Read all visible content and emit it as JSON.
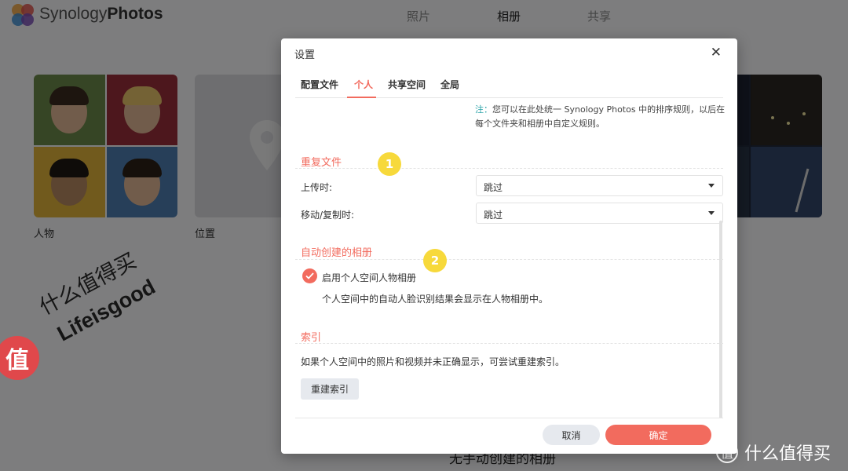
{
  "app": {
    "brand_light": "Synology",
    "brand_bold": "Photos",
    "nav": [
      "照片",
      "相册",
      "共享"
    ],
    "albums": [
      {
        "label": "人物"
      },
      {
        "label": "位置"
      }
    ],
    "bottom_text": "无手动创建的相册"
  },
  "dialog": {
    "title": "设置",
    "close_icon": "close-icon",
    "tabs": [
      "配置文件",
      "个人",
      "共享空间",
      "全局"
    ],
    "active_tab": "个人",
    "note_label": "注：",
    "note_text": "您可以在此处统一 Synology Photos 中的排序规则，以后在每个文件夹和相册中自定义规则。",
    "sections": {
      "duplicates": {
        "title": "重复文件",
        "upload_label": "上传时:",
        "upload_value": "跳过",
        "move_label": "移动/复制时:",
        "move_value": "跳过"
      },
      "auto_album": {
        "title": "自动创建的相册",
        "checkbox_label": "启用个人空间人物相册",
        "checkbox_checked": true,
        "description": "个人空间中的自动人脸识别结果会显示在人物相册中。"
      },
      "index": {
        "title": "索引",
        "description": "如果个人空间中的照片和视频并未正确显示，可尝试重建索引。",
        "button": "重建索引"
      }
    },
    "buttons": {
      "cancel": "取消",
      "ok": "确定"
    },
    "annotations": [
      "1",
      "2"
    ]
  },
  "watermark": {
    "line1": "什么值得买",
    "line2": "Lifeisgood",
    "badge": "值",
    "corner_icon": "值",
    "corner_text": "什么值得买"
  },
  "colors": {
    "accent": "#f26b5e",
    "note": "#2aa3a8",
    "annotation": "#f7d93b"
  }
}
